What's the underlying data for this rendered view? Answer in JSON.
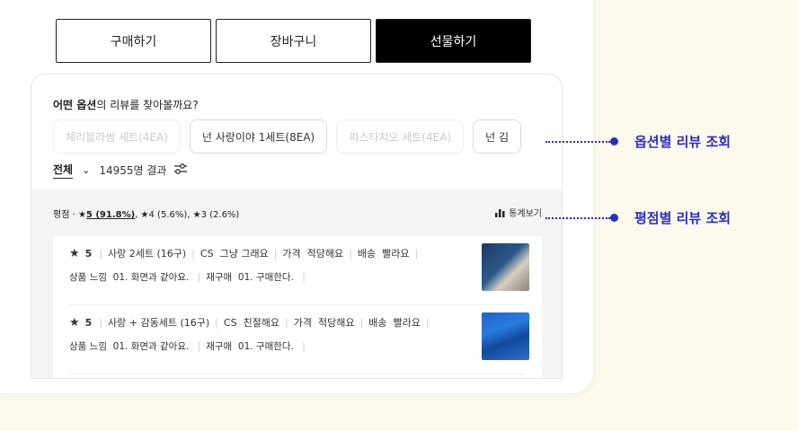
{
  "tabs": [
    "구매하기",
    "장바구니",
    "선물하기"
  ],
  "question": {
    "bold": "어떤 옵션",
    "rest": "의 리뷰를 찾아볼까요?"
  },
  "chips": [
    "체리블라썸 세트(4EA)",
    "넌 사랑이야 1세트(8EA)",
    "피스타치오 세트(4EA)",
    "넌 김"
  ],
  "filter": {
    "all": "전체",
    "chevron": "⌄",
    "count": "14955명 결과"
  },
  "ratings": {
    "label": "평점 · ",
    "star": "★",
    "top": "5 (91.8%)",
    "second": ", ★4 (5.6%), ★3 (2.6%)"
  },
  "stats_label": "통계보기",
  "reviews": [
    {
      "star": "★",
      "score": "5",
      "option": "사랑 2세트 (16구)",
      "cs_label": "CS",
      "cs_value": "그냥 그래요",
      "price_label": "가격",
      "price_value": "적당해요",
      "ship_label": "배송",
      "ship_value": "빨라요",
      "feel_label": "상품 느낌",
      "feel_value": "01. 화면과 같아요.",
      "rebuy_label": "재구매",
      "rebuy_value": "01. 구매한다."
    },
    {
      "star": "★",
      "score": "5",
      "option": "사랑 + 감동세트 (16구)",
      "cs_label": "CS",
      "cs_value": "친절해요",
      "price_label": "가격",
      "price_value": "적당해요",
      "ship_label": "배송",
      "ship_value": "빨라요",
      "feel_label": "상품 느낌",
      "feel_value": "01. 화면과 같아요.",
      "rebuy_label": "재구매",
      "rebuy_value": "01. 구매한다."
    }
  ],
  "annotations": {
    "option_review": "옵션별 리뷰 조회",
    "rating_review": "평점별 리뷰 조회"
  },
  "colors": {
    "accent": "#2a2fbf",
    "background": "#fdf9ec"
  }
}
